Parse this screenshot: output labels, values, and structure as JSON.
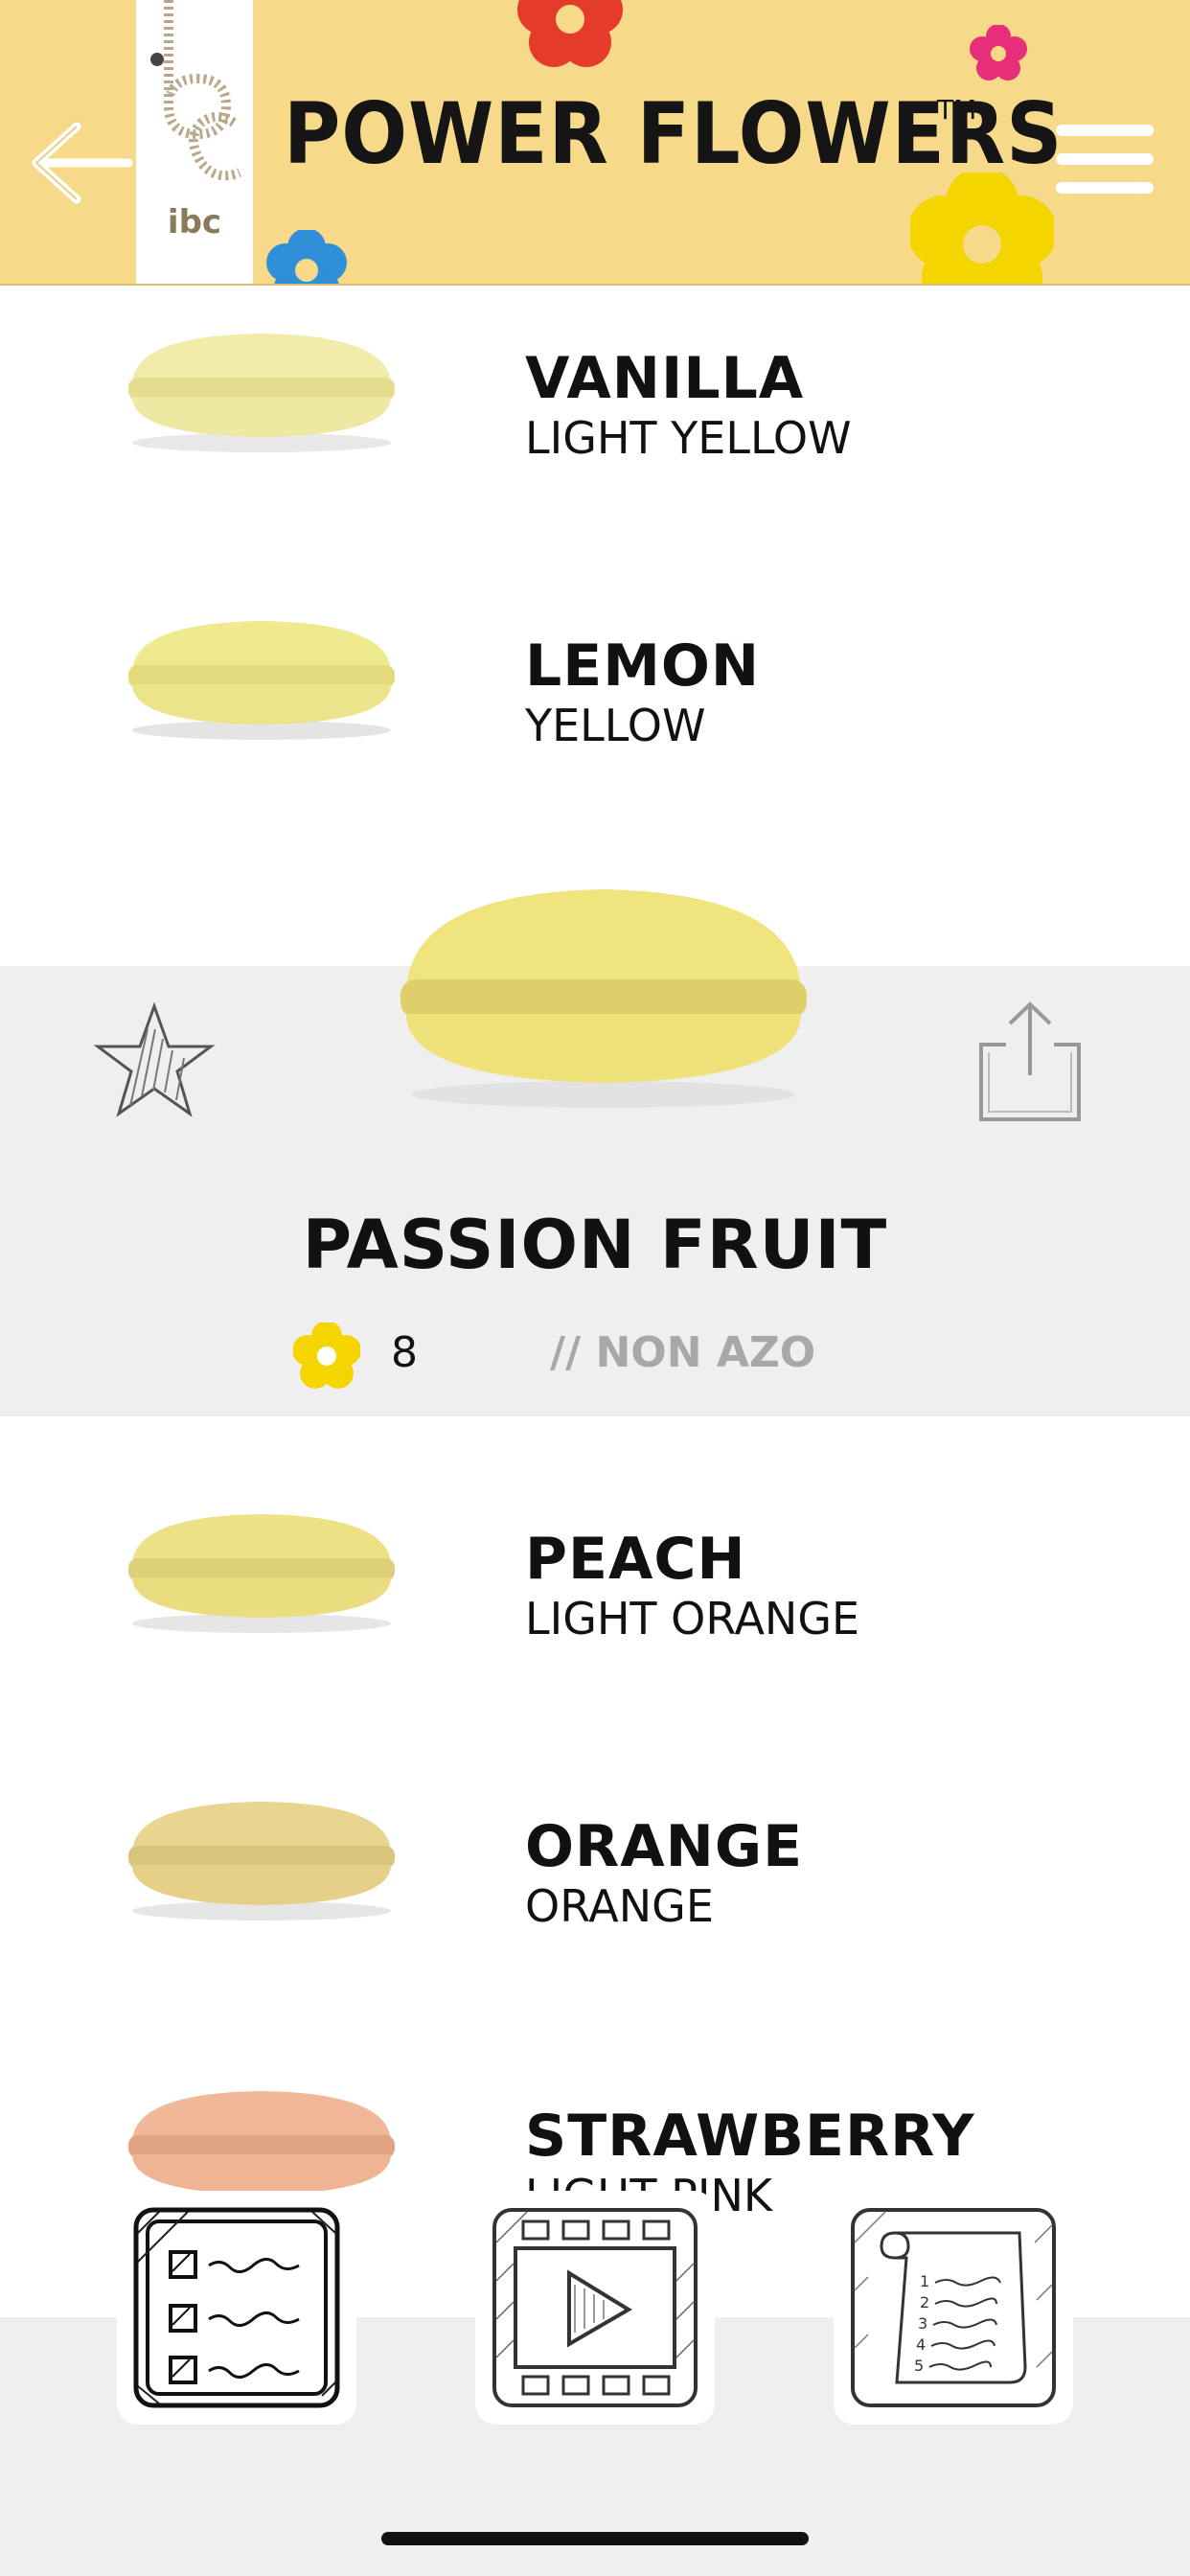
{
  "header": {
    "title": "POWER FLOWERS",
    "trademark": "TM",
    "logo_text": "ibc"
  },
  "list": [
    {
      "name": "VANILLA",
      "color": "LIGHT YELLOW",
      "swatch": "#f2ecaa"
    },
    {
      "name": "LEMON",
      "color": "YELLOW",
      "swatch": "#efe98f"
    },
    {
      "name": "PEACH",
      "color": "LIGHT ORANGE",
      "swatch": "#ece184"
    },
    {
      "name": "ORANGE",
      "color": "ORANGE",
      "swatch": "#e8d58f"
    },
    {
      "name": "STRAWBERRY",
      "color": "LIGHT PINK",
      "swatch": "#f0b898"
    }
  ],
  "selected": {
    "name": "PASSION FRUIT",
    "count": "8",
    "tag": "// NON AZO",
    "swatch": "#f0e47e"
  },
  "colors": {
    "header_bg": "#f7d98a",
    "selected_bg": "#efefef",
    "flower_yellow": "#f5d500",
    "flower_red": "#e53b2c",
    "flower_pink": "#e8307a",
    "flower_blue": "#2f8fd8"
  },
  "icons": {
    "back": "arrow-left-icon",
    "menu": "hamburger-menu-icon",
    "favorite": "star-icon",
    "share": "share-icon",
    "tab_list": "checklist-icon",
    "tab_video": "video-play-icon",
    "tab_scroll": "numbered-scroll-icon"
  }
}
